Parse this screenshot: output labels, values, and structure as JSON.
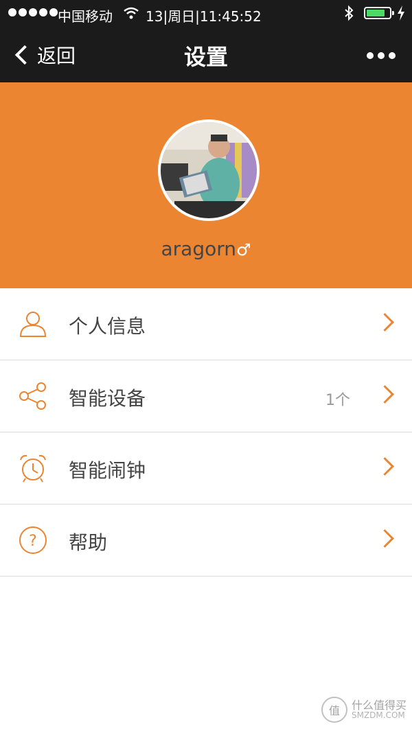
{
  "status_bar": {
    "carrier": "中国移动",
    "time": "13|周日|11:45:52",
    "bluetooth": "bluetooth-icon",
    "battery": "battery-icon",
    "battery_level": 0.8,
    "battery_color": "#4cd964"
  },
  "nav": {
    "back_label": "返回",
    "title": "设置",
    "more_icon": "more-icon"
  },
  "profile": {
    "username": "aragorn",
    "gender_symbol": "♂",
    "header_color": "#ec8532"
  },
  "menu": {
    "items": [
      {
        "label": "个人信息",
        "icon": "person-icon",
        "count": ""
      },
      {
        "label": "智能设备",
        "icon": "share-icon",
        "count": "1个"
      },
      {
        "label": "智能闹钟",
        "icon": "alarm-clock-icon",
        "count": ""
      },
      {
        "label": "帮助",
        "icon": "help-icon",
        "count": ""
      }
    ],
    "accent_color": "#ec8532"
  },
  "watermark": {
    "seal": "值",
    "main": "什么值得买",
    "sub": "SMZDM.COM"
  }
}
